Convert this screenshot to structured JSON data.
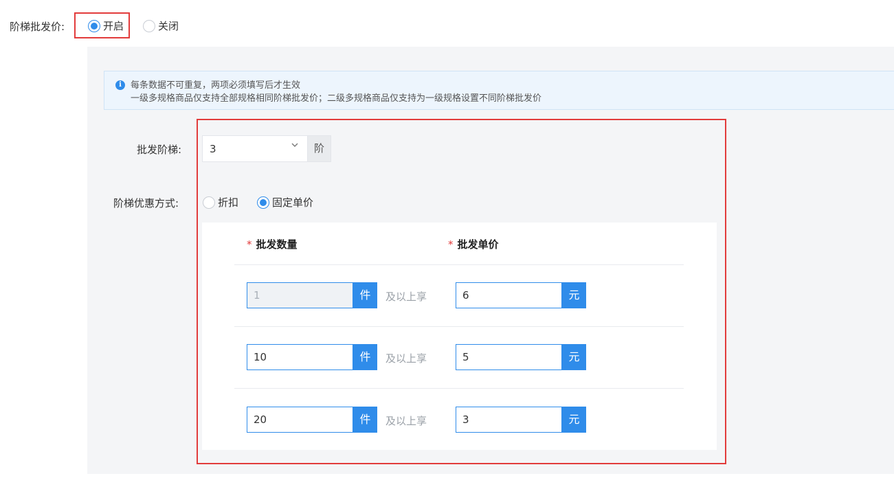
{
  "wholesale_price": {
    "label": "阶梯批发价:",
    "options": [
      {
        "label": "开启",
        "checked": true
      },
      {
        "label": "关闭",
        "checked": false
      }
    ]
  },
  "notice": {
    "icon": "info-icon",
    "icon_glyph": "i",
    "line1": "每条数据不可重复，两项必须填写后才生效",
    "line2": "一级多规格商品仅支持全部规格相同阶梯批发价；二级多规格商品仅支持为一级规格设置不同阶梯批发价"
  },
  "tier": {
    "label": "批发阶梯:",
    "value": "3",
    "suffix": "阶"
  },
  "mode": {
    "label": "阶梯优惠方式:",
    "options": [
      {
        "label": "折扣",
        "checked": false
      },
      {
        "label": "固定单价",
        "checked": true
      }
    ]
  },
  "table": {
    "required_mark": "*",
    "col_qty": "批发数量",
    "col_price": "批发单价",
    "qty_unit": "件",
    "enjoy_text": "及以上享",
    "price_unit": "元",
    "rows": [
      {
        "qty": "1",
        "price": "6",
        "qty_disabled": true
      },
      {
        "qty": "10",
        "price": "5",
        "qty_disabled": false
      },
      {
        "qty": "20",
        "price": "3",
        "qty_disabled": false
      }
    ]
  },
  "colors": {
    "accent": "#2f8cea",
    "highlight": "#e23b3b",
    "panel_bg": "#f4f5f7"
  }
}
